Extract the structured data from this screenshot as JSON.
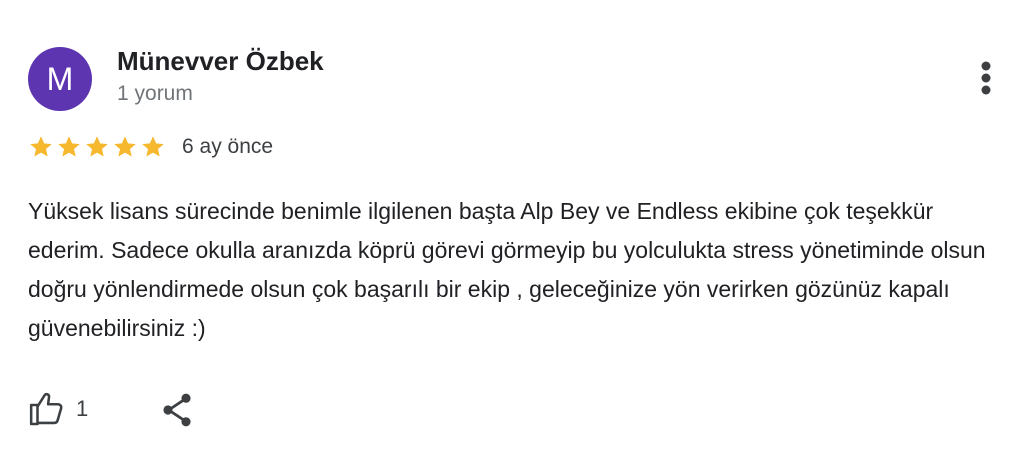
{
  "review": {
    "author": {
      "initial": "M",
      "name": "Münevver Özbek",
      "review_count": "1 yorum",
      "avatar_color": "#5e35b1"
    },
    "rating": {
      "stars": 5,
      "max": 5,
      "star_color": "#f5b82e"
    },
    "time": "6 ay önce",
    "text": "Yüksek lisans sürecinde benimle ilgilenen başta Alp Bey ve Endless ekibine çok teşekkür ederim. Sadece okulla aranızda köprü görevi görmeyip bu yolculukta stress yönetiminde olsun doğru yönlendirmede olsun çok başarılı bir ekip , geleceğinize yön verirken gözünüz kapalı güvenebilirsiniz :)",
    "actions": {
      "like_icon": "thumbs-up-icon",
      "like_count": "1",
      "share_icon": "share-icon",
      "more_icon": "more-vert-icon"
    }
  }
}
